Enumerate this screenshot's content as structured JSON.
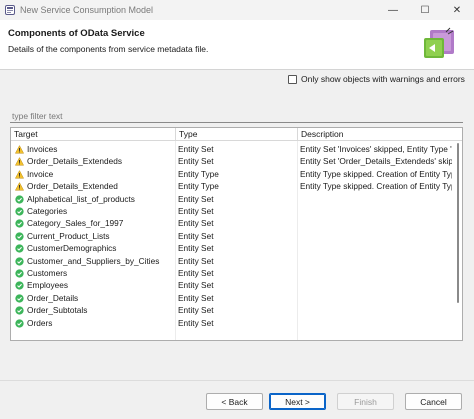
{
  "window": {
    "title": "New Service Consumption Model",
    "minimize_glyph": "—",
    "maximize_glyph": "☐",
    "close_glyph": "✕"
  },
  "header": {
    "title": "Components of OData Service",
    "description": "Details of the components from service metadata file."
  },
  "options": {
    "warnings_checkbox_label": "Only show objects with warnings and errors",
    "warnings_checked": false
  },
  "filter": {
    "placeholder": "type filter text",
    "value": ""
  },
  "table": {
    "columns": [
      "Target",
      "Type",
      "Description"
    ],
    "rows": [
      {
        "status": "warning",
        "target": "Invoices",
        "type": "Entity Set",
        "description": "Entity Set 'Invoices'  skipped, Entity Type '"
      },
      {
        "status": "warning",
        "target": "Order_Details_Extendeds",
        "type": "Entity Set",
        "description": "Entity Set 'Order_Details_Extendeds'  skipp"
      },
      {
        "status": "warning",
        "target": "Invoice",
        "type": "Entity Type",
        "description": "Entity Type skipped. Creation of Entity Typ"
      },
      {
        "status": "warning",
        "target": "Order_Details_Extended",
        "type": "Entity Type",
        "description": "Entity Type skipped. Creation of Entity Typ"
      },
      {
        "status": "ok",
        "target": "Alphabetical_list_of_products",
        "type": "Entity Set",
        "description": ""
      },
      {
        "status": "ok",
        "target": "Categories",
        "type": "Entity Set",
        "description": ""
      },
      {
        "status": "ok",
        "target": "Category_Sales_for_1997",
        "type": "Entity Set",
        "description": ""
      },
      {
        "status": "ok",
        "target": "Current_Product_Lists",
        "type": "Entity Set",
        "description": ""
      },
      {
        "status": "ok",
        "target": "CustomerDemographics",
        "type": "Entity Set",
        "description": ""
      },
      {
        "status": "ok",
        "target": "Customer_and_Suppliers_by_Cities",
        "type": "Entity Set",
        "description": ""
      },
      {
        "status": "ok",
        "target": "Customers",
        "type": "Entity Set",
        "description": ""
      },
      {
        "status": "ok",
        "target": "Employees",
        "type": "Entity Set",
        "description": ""
      },
      {
        "status": "ok",
        "target": "Order_Details",
        "type": "Entity Set",
        "description": ""
      },
      {
        "status": "ok",
        "target": "Order_Subtotals",
        "type": "Entity Set",
        "description": ""
      },
      {
        "status": "ok",
        "target": "Orders",
        "type": "Entity Set",
        "description": ""
      }
    ]
  },
  "buttons": {
    "back": "< Back",
    "next": "Next >",
    "finish": "Finish",
    "cancel": "Cancel"
  },
  "colors": {
    "warning": "#f2c12e",
    "ok": "#3cb55a",
    "accent": "#0a64c8"
  },
  "icons": {
    "warning": "warning-triangle-icon",
    "ok": "check-circle-icon",
    "wizard": "wizard-banner-icon"
  }
}
